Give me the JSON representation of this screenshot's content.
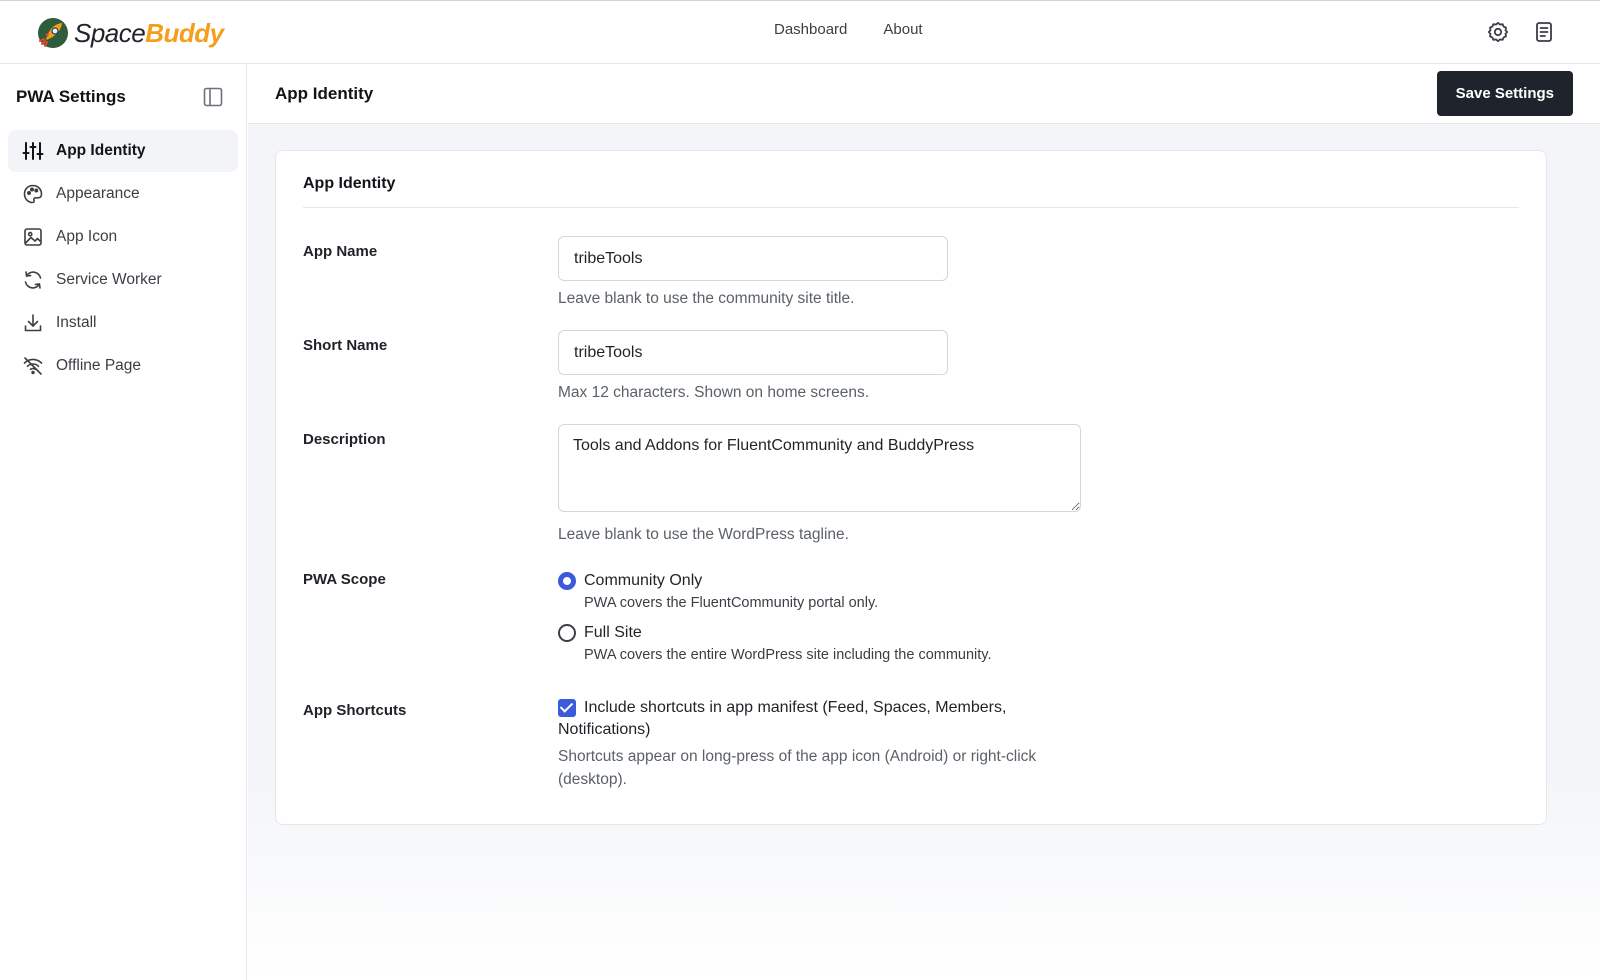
{
  "brand": {
    "name_part1": "Space",
    "name_part2": "Buddy"
  },
  "topnav": {
    "items": [
      {
        "label": "Dashboard"
      },
      {
        "label": "About"
      }
    ]
  },
  "sidebar": {
    "title": "PWA Settings",
    "items": [
      {
        "label": "App Identity",
        "icon": "sliders-icon",
        "active": true
      },
      {
        "label": "Appearance",
        "icon": "palette-icon"
      },
      {
        "label": "App Icon",
        "icon": "image-icon"
      },
      {
        "label": "Service Worker",
        "icon": "refresh-icon"
      },
      {
        "label": "Install",
        "icon": "download-icon"
      },
      {
        "label": "Offline Page",
        "icon": "wifi-off-icon"
      }
    ]
  },
  "header": {
    "title": "App Identity",
    "save_label": "Save Settings"
  },
  "card": {
    "title": "App Identity",
    "app_name": {
      "label": "App Name",
      "value": "tribeTools",
      "help": "Leave blank to use the community site title."
    },
    "short_name": {
      "label": "Short Name",
      "value": "tribeTools",
      "help": "Max 12 characters. Shown on home screens."
    },
    "description": {
      "label": "Description",
      "value": "Tools and Addons for FluentCommunity and BuddyPress",
      "help": "Leave blank to use the WordPress tagline."
    },
    "scope": {
      "label": "PWA Scope",
      "options": [
        {
          "label": "Community Only",
          "desc": "PWA covers the FluentCommunity portal only.",
          "checked": true
        },
        {
          "label": "Full Site",
          "desc": "PWA covers the entire WordPress site including the community.",
          "checked": false
        }
      ]
    },
    "shortcuts": {
      "label": "App Shortcuts",
      "checkbox_label": "Include shortcuts in app manifest (Feed, Spaces, Members, Notifications)",
      "checked": true,
      "help": "Shortcuts appear on long-press of the app icon (Android) or right-click (desktop)."
    }
  },
  "colors": {
    "accent": "#3b5bdb",
    "brand_orange": "#f59e1b",
    "button_dark": "#1f232b"
  }
}
